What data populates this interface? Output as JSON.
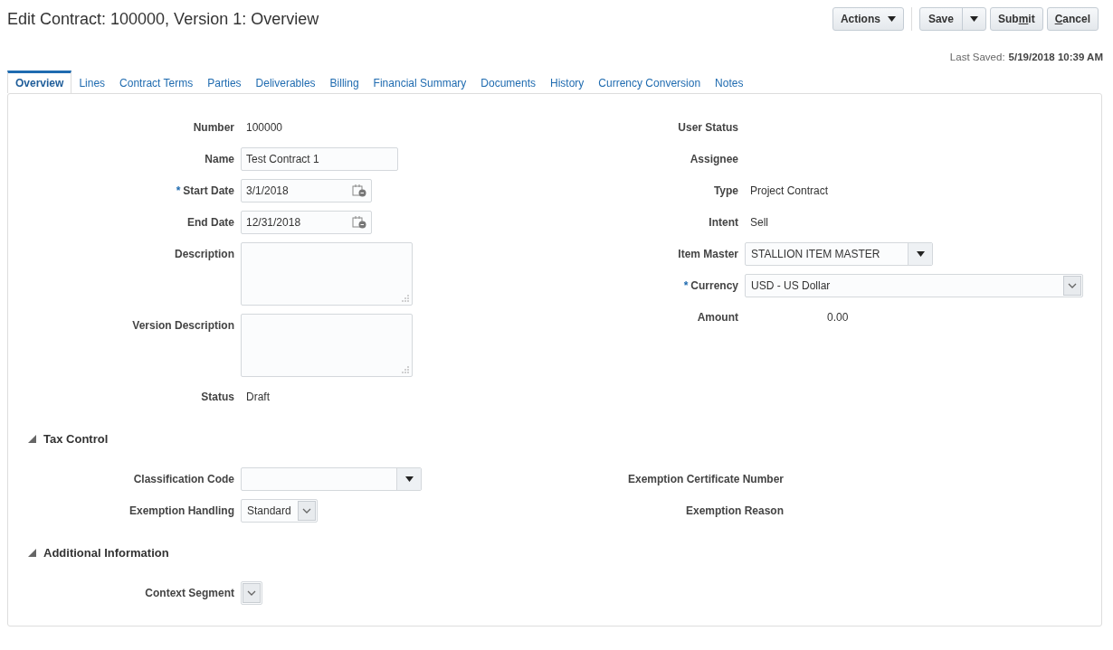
{
  "page": {
    "title": "Edit Contract: 100000, Version 1: Overview",
    "last_saved_label": "Last Saved:",
    "last_saved_value": "5/19/2018 10:39 AM"
  },
  "toolbar": [
    {
      "kind": "menu",
      "label_parts": [
        {
          "text": "Actions",
          "underlined": false
        }
      ]
    },
    {
      "kind": "split",
      "label_parts": [
        {
          "text": "Save",
          "underlined": false
        }
      ]
    },
    {
      "kind": "plain",
      "label_parts": [
        {
          "text": "Sub",
          "underlined": false
        },
        {
          "text": "m",
          "underlined": true
        },
        {
          "text": "it",
          "underlined": false
        }
      ]
    },
    {
      "kind": "plain",
      "label_parts": [
        {
          "text": "C",
          "underlined": true
        },
        {
          "text": "ancel",
          "underlined": false
        }
      ]
    }
  ],
  "tabs": [
    {
      "label": "Overview",
      "selected": true
    },
    {
      "label": "Lines",
      "selected": false
    },
    {
      "label": "Contract Terms",
      "selected": false
    },
    {
      "label": "Parties",
      "selected": false
    },
    {
      "label": "Deliverables",
      "selected": false
    },
    {
      "label": "Billing",
      "selected": false
    },
    {
      "label": "Financial Summary",
      "selected": false
    },
    {
      "label": "Documents",
      "selected": false
    },
    {
      "label": "History",
      "selected": false
    },
    {
      "label": "Currency Conversion",
      "selected": false
    },
    {
      "label": "Notes",
      "selected": false
    }
  ],
  "overview": {
    "left": [
      {
        "label": "Number",
        "kind": "text",
        "value": "100000"
      },
      {
        "label": "Name",
        "kind": "input",
        "value": "Test Contract 1"
      },
      {
        "label": "Start Date",
        "kind": "date",
        "value": "3/1/2018",
        "required_mark": "*"
      },
      {
        "label": "End Date",
        "kind": "date",
        "value": "12/31/2018"
      },
      {
        "label": "Description",
        "kind": "textarea"
      },
      {
        "label": "Version Description",
        "kind": "textarea"
      },
      {
        "label": "Status",
        "kind": "text",
        "value": "Draft"
      }
    ],
    "right": [
      {
        "label": "User Status"
      },
      {
        "label": "Assignee"
      },
      {
        "label": "Type",
        "kind": "text",
        "value": "Project Contract"
      },
      {
        "label": "Intent",
        "kind": "text",
        "value": "Sell"
      },
      {
        "label": "Item Master",
        "kind": "select",
        "value": "STALLION ITEM MASTER"
      },
      {
        "label": "Currency",
        "kind": "choice",
        "value": "USD - US Dollar",
        "required_mark": "*"
      },
      {
        "label": "Amount",
        "kind": "amount",
        "value": "0.00"
      }
    ]
  },
  "sections": [
    {
      "title": "Tax Control",
      "expanded": true,
      "left": [
        {
          "label": "Classification Code",
          "kind": "select"
        },
        {
          "label": "Exemption Handling",
          "kind": "choice",
          "value": "Standard"
        }
      ],
      "right": [
        {
          "label": "Exemption Certificate Number"
        },
        {
          "label": "Exemption Reason"
        }
      ]
    },
    {
      "title": "Additional Information",
      "expanded": true,
      "left": [
        {
          "label": "Context Segment",
          "kind": "choice"
        }
      ]
    }
  ]
}
